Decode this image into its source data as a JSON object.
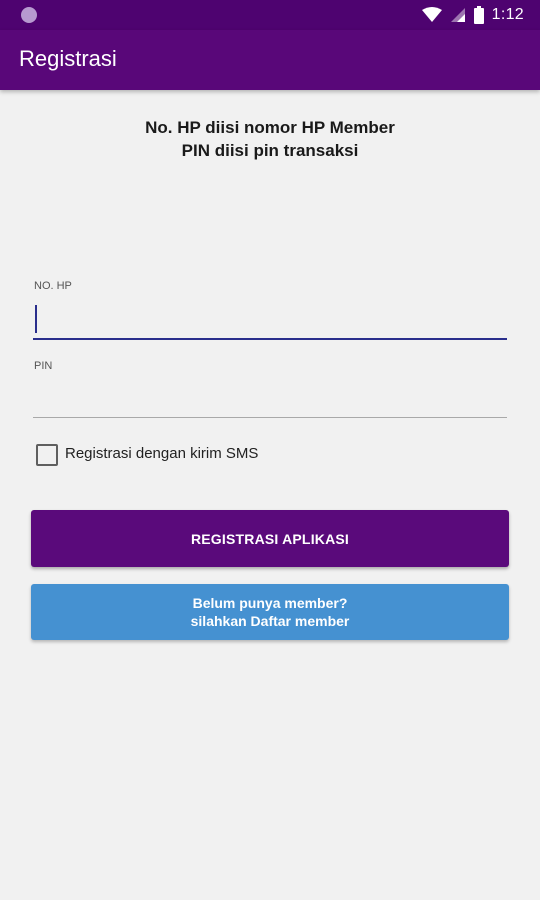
{
  "status_bar": {
    "time": "1:12",
    "icons": [
      "notification-dot-icon",
      "wifi-icon",
      "signal-icon",
      "battery-icon"
    ]
  },
  "app_bar": {
    "title": "Registrasi"
  },
  "instructions": {
    "line1": "No. HP diisi nomor HP Member",
    "line2": "PIN diisi pin transaksi"
  },
  "form": {
    "phone_label": "NO. HP",
    "phone_value": "",
    "pin_label": "PIN",
    "pin_value": "",
    "sms_checkbox_label": "Registrasi dengan kirim SMS",
    "sms_checked": false
  },
  "buttons": {
    "register_label": "REGISTRASI APLIKASI",
    "daftar_line1": "Belum punya member?",
    "daftar_line2": "silahkan Daftar member"
  },
  "colors": {
    "status_bar": "#4e0370",
    "app_bar": "#590779",
    "primary_button": "#5a0a7b",
    "secondary_button": "#4591d1",
    "focus_underline": "#2a2e8c",
    "background": "#f1f1f1"
  }
}
